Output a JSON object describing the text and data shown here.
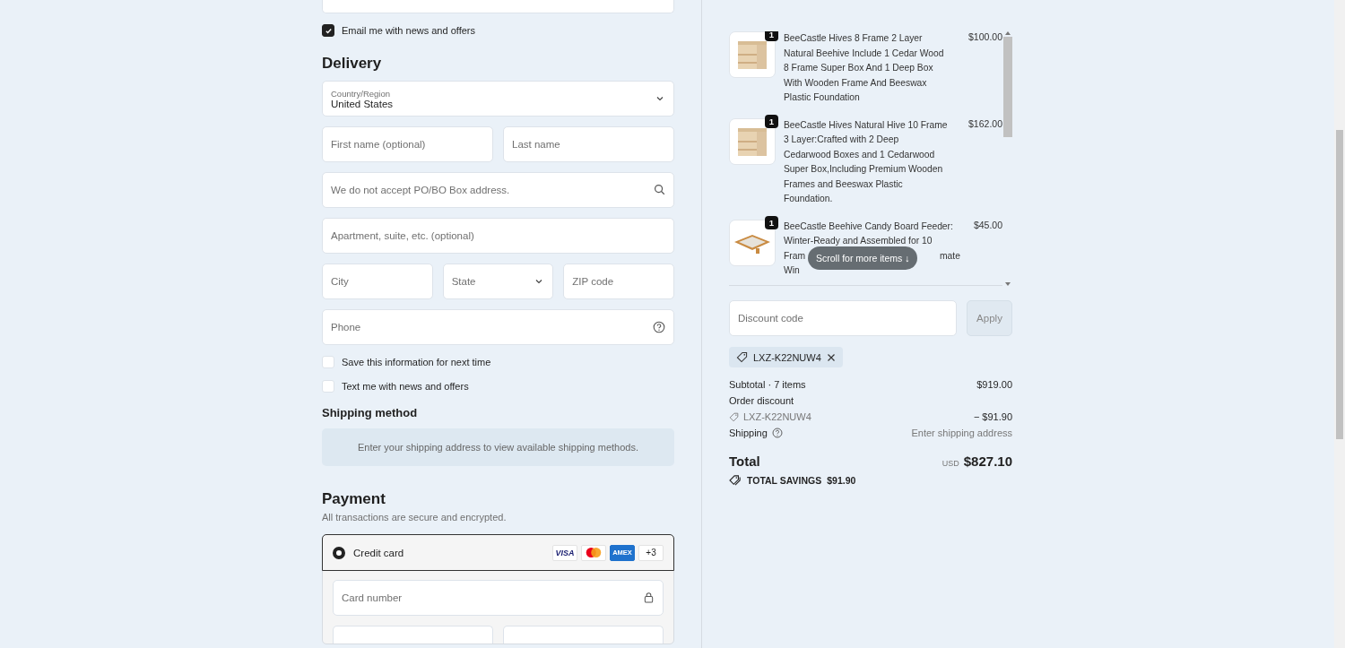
{
  "contact": {
    "email_offers": {
      "label": "Email me with news and offers",
      "checked": true
    }
  },
  "delivery": {
    "title": "Delivery",
    "country": {
      "label": "Country/Region",
      "value": "United States"
    },
    "first_name": {
      "placeholder": "First name (optional)"
    },
    "last_name": {
      "placeholder": "Last name"
    },
    "address": {
      "placeholder": "We do not accept PO/BO Box address."
    },
    "apartment": {
      "placeholder": "Apartment, suite, etc. (optional)"
    },
    "city": {
      "placeholder": "City"
    },
    "state": {
      "placeholder": "State"
    },
    "zip": {
      "placeholder": "ZIP code"
    },
    "phone": {
      "placeholder": "Phone"
    },
    "checkboxes": [
      {
        "label": "Save this information for next time",
        "checked": false
      },
      {
        "label": "Text me with news and offers",
        "checked": false
      }
    ]
  },
  "shipping_method": {
    "title": "Shipping method",
    "notice": "Enter your shipping address to view available shipping methods."
  },
  "payment": {
    "title": "Payment",
    "subtitle": "All transactions are secure and encrypted.",
    "option": {
      "label": "Credit card",
      "selected": true
    },
    "card_logos": [
      {
        "kind": "visa",
        "label": "VISA"
      },
      {
        "kind": "mastercard"
      },
      {
        "kind": "amex",
        "label": "AMEX"
      }
    ],
    "more_cards": "+3",
    "card_number": {
      "placeholder": "Card number"
    }
  },
  "cart": {
    "items": [
      {
        "quantity": "1",
        "lines": [
          "BeeCastle Hives 8 Frame 2 Layer",
          "Natural Beehive Include 1 Cedar Wood",
          "8 Frame Super Box And 1 Deep Box",
          "With Wooden Frame And Beeswax",
          "Plastic Foundation"
        ],
        "price": "$100.00",
        "kind": "hive"
      },
      {
        "quantity": "1",
        "lines": [
          "BeeCastle Hives Natural Hive 10 Frame",
          "3 Layer:Crafted with 2 Deep",
          "Cedarwood Boxes and 1 Cedarwood",
          "Super Box,Including Premium Wooden",
          "Frames and Beeswax Plastic",
          "Foundation."
        ],
        "price": "$162.00",
        "kind": "hive"
      },
      {
        "quantity": "1",
        "lines": [
          "BeeCastle Beehive Candy Board Feeder:",
          "Winter-Ready and Assembled for 10"
        ],
        "covered_parts": [
          [
            "Fram",
            "mate"
          ],
          [
            "Win"
          ]
        ],
        "price": "$45.00",
        "kind": "tray"
      }
    ],
    "scroll_hint": "Scroll for more items ↓"
  },
  "discount": {
    "placeholder": "Discount code",
    "apply": "Apply",
    "applied_code": "LXZ-K22NUW4"
  },
  "summary": {
    "subtotal_label": "Subtotal · 7 items",
    "subtotal": "$919.00",
    "order_discount_label": "Order discount",
    "discount_code": "LXZ-K22NUW4",
    "discount_amount": "− $91.90",
    "shipping_label": "Shipping",
    "shipping_value": "Enter shipping address",
    "total_label": "Total",
    "currency": "USD",
    "total": "$827.10",
    "savings_label": "TOTAL SAVINGS",
    "savings": "$91.90"
  }
}
